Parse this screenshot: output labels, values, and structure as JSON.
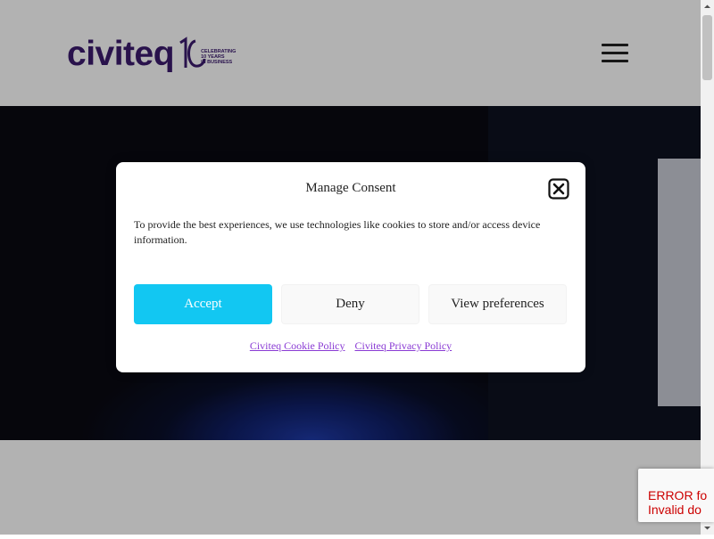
{
  "header": {
    "logo_text": "civiteq",
    "logo_badge_number": "10",
    "logo_tagline": "CELEBRATING\n10 YEARS\nIN BUSINESS",
    "menu_icon": "hamburger-menu-icon"
  },
  "consent": {
    "title": "Manage Consent",
    "body": "To provide the best experiences, we use technologies like cookies to store and/or access device information.",
    "accept_label": "Accept",
    "deny_label": "Deny",
    "preferences_label": "View preferences",
    "cookie_policy_link": "Civiteq Cookie Policy",
    "privacy_policy_link": "Civiteq Privacy Policy",
    "close_icon": "close-icon"
  },
  "recaptcha": {
    "line1": "ERROR fo",
    "line2": "Invalid do"
  },
  "colors": {
    "brand": "#3b1a6e",
    "accept": "#12c7f2",
    "link": "#8a3bd4",
    "error": "#cc0000"
  }
}
